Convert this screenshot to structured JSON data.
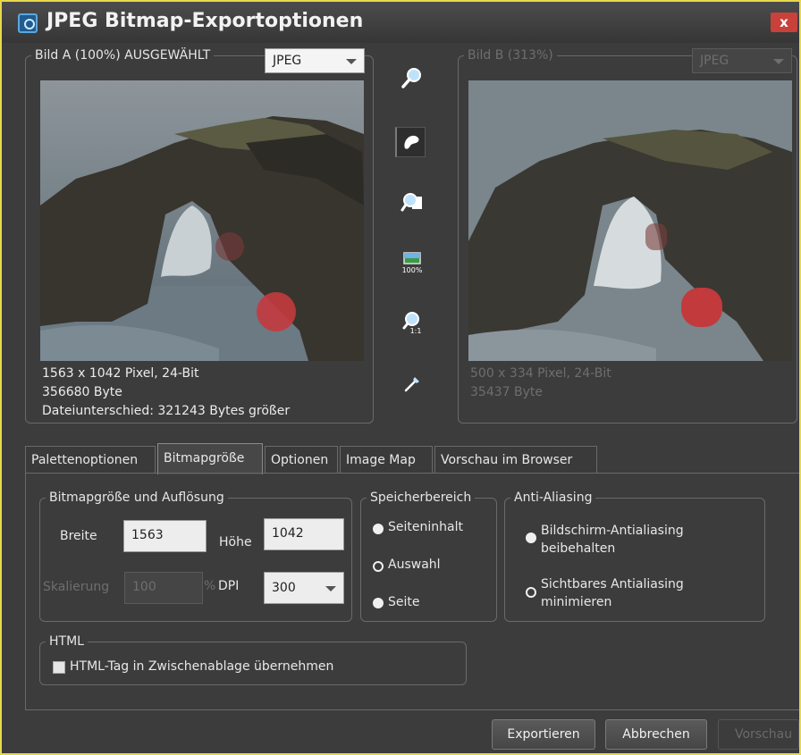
{
  "window": {
    "title": "JPEG Bitmap-Exportoptionen",
    "close": "x"
  },
  "image_a": {
    "label": "Bild A (100%) AUSGEWÄHLT",
    "format": "JPEG",
    "info": [
      "1563 x 1042 Pixel, 24-Bit",
      "356680 Byte",
      "Dateiunterschied: 321243 Bytes größer"
    ]
  },
  "image_b": {
    "label": "Bild B (313%)",
    "format": "JPEG",
    "info": [
      "500 x 334 Pixel, 24-Bit",
      "35437 Byte"
    ]
  },
  "toolbar": {
    "icons": [
      "zoom-icon",
      "pan-hand-icon",
      "zoom-page-icon",
      "zoom-100-icon",
      "zoom-1to1-icon",
      "color-picker-icon"
    ],
    "zoom_100_label": "100%",
    "zoom_1to1_label": "1:1"
  },
  "tabs": [
    {
      "label": "Palettenoptionen",
      "active": false
    },
    {
      "label": "Bitmapgröße",
      "active": true
    },
    {
      "label": "Optionen",
      "active": false
    },
    {
      "label": "Image Map",
      "active": false
    },
    {
      "label": "Vorschau im Browser",
      "active": false
    }
  ],
  "bitmap": {
    "group_label": "Bitmapgröße und Auflösung",
    "width_label": "Breite",
    "width_value": "1563",
    "height_label": "Höhe",
    "height_value": "1042",
    "scale_label": "Skalierung",
    "scale_value": "100",
    "percent": "%",
    "dpi_label": "DPI",
    "dpi_value": "300"
  },
  "storage": {
    "group_label": "Speicherbereich",
    "options": [
      {
        "label": "Seiteninhalt",
        "selected": true
      },
      {
        "label": "Auswahl",
        "selected": false
      },
      {
        "label": "Seite",
        "selected": true
      }
    ]
  },
  "antialias": {
    "group_label": "Anti-Aliasing",
    "options": [
      {
        "label_line1": "Bildschirm-Antialiasing",
        "label_line2": "beibehalten",
        "selected": true
      },
      {
        "label_line1": "Sichtbares Antialiasing",
        "label_line2": "minimieren",
        "selected": false
      }
    ]
  },
  "html_group": {
    "group_label": "HTML",
    "checkbox_label": "HTML-Tag in Zwischenablage übernehmen",
    "checked": false
  },
  "buttons": {
    "export": "Exportieren",
    "cancel": "Abbrechen",
    "preview": "Vorschau"
  }
}
